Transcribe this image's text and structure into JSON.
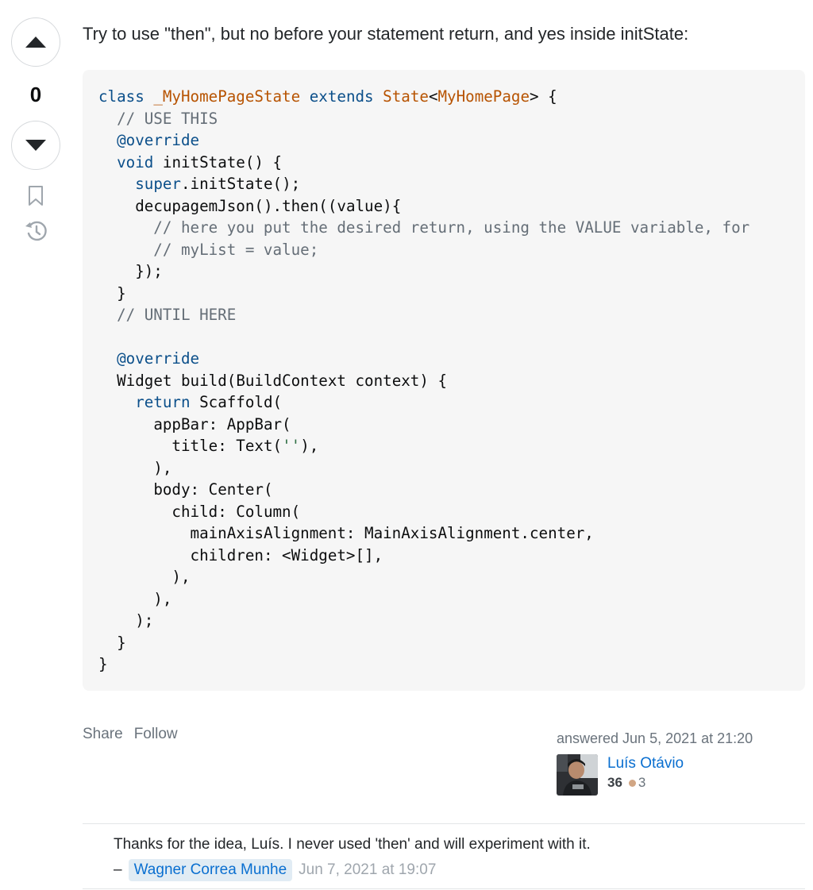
{
  "vote": {
    "score": "0",
    "upvote_icon": "triangle-up-icon",
    "downvote_icon": "triangle-down-icon",
    "bookmark_icon": "bookmark-icon",
    "history_icon": "history-icon"
  },
  "answer": {
    "intro": "Try to use \"then\", but no before your statement return, and yes inside initState:",
    "code_lines": [
      "class _MyHomePageState extends State<MyHomePage> {",
      "  // USE THIS",
      "  @override",
      "  void initState() {",
      "    super.initState();",
      "    decupagemJson().then((value){",
      "      // here you put the desired return, using the VALUE variable, for",
      "      // myList = value;",
      "    });",
      "  }",
      "  // UNTIL HERE",
      "",
      "  @override",
      "  Widget build(BuildContext context) {",
      "    return Scaffold(",
      "      appBar: AppBar(",
      "        title: Text(''),",
      "      ),",
      "      body: Center(",
      "        child: Column(",
      "          mainAxisAlignment: MainAxisAlignment.center,",
      "          children: <Widget>[],",
      "        ),",
      "      ),",
      "    );",
      "  }",
      "}"
    ]
  },
  "post_menu": {
    "share": "Share",
    "follow": "Follow"
  },
  "user_card": {
    "action": "answered Jun 5, 2021 at 21:20",
    "name": "Luís Otávio",
    "reputation": "36",
    "bronze_badges": "3",
    "bronze_color": "#d1a684"
  },
  "comments": [
    {
      "text": "Thanks for the idea, Luís. I never used 'then' and will experiment with it.",
      "dash": "–",
      "user": "Wagner Correa Munhe",
      "date": "Jun 7, 2021 at 19:07"
    }
  ],
  "colors": {
    "link": "#0a6fd0",
    "muted": "#6a737c",
    "code_bg": "#f6f6f6",
    "keyword": "#0b4f8a",
    "type": "#b75301"
  }
}
